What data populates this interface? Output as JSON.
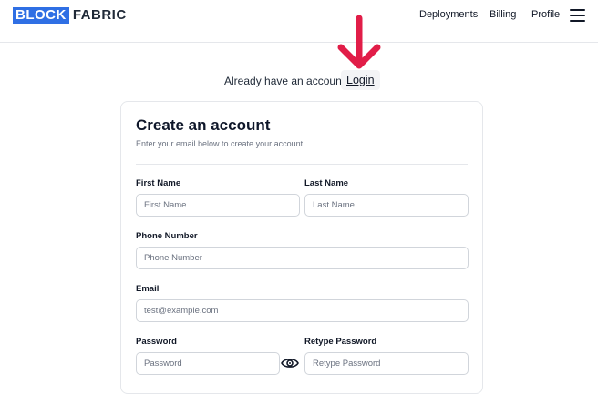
{
  "header": {
    "logo_part1": "BLOCK",
    "logo_part2": "FABRIC",
    "nav_links": [
      "Deployments",
      "Billing",
      "Profile"
    ],
    "menu_icon": "hamburger-menu-icon"
  },
  "annotation": {
    "arrow_icon": "down-arrow-annotation-icon",
    "arrow_color": "#e11d48"
  },
  "account_prompt": {
    "text": "Already have an account?",
    "login_label": "Login"
  },
  "form": {
    "title": "Create an account",
    "subtitle": "Enter your email below to create your account",
    "first_name": {
      "label": "First Name",
      "placeholder": "First Name",
      "value": ""
    },
    "last_name": {
      "label": "Last Name",
      "placeholder": "Last Name",
      "value": ""
    },
    "phone": {
      "label": "Phone Number",
      "placeholder": "Phone Number",
      "value": ""
    },
    "email": {
      "label": "Email",
      "placeholder": "test@example.com",
      "value": ""
    },
    "password": {
      "label": "Password",
      "placeholder": "Password",
      "value": "",
      "toggle_icon": "eye-icon"
    },
    "retype_password": {
      "label": "Retype Password",
      "placeholder": "Retype Password",
      "value": ""
    }
  },
  "colors": {
    "brand_blue": "#2f6fe4",
    "arrow_red": "#e11d48",
    "border": "#e5e7eb"
  }
}
